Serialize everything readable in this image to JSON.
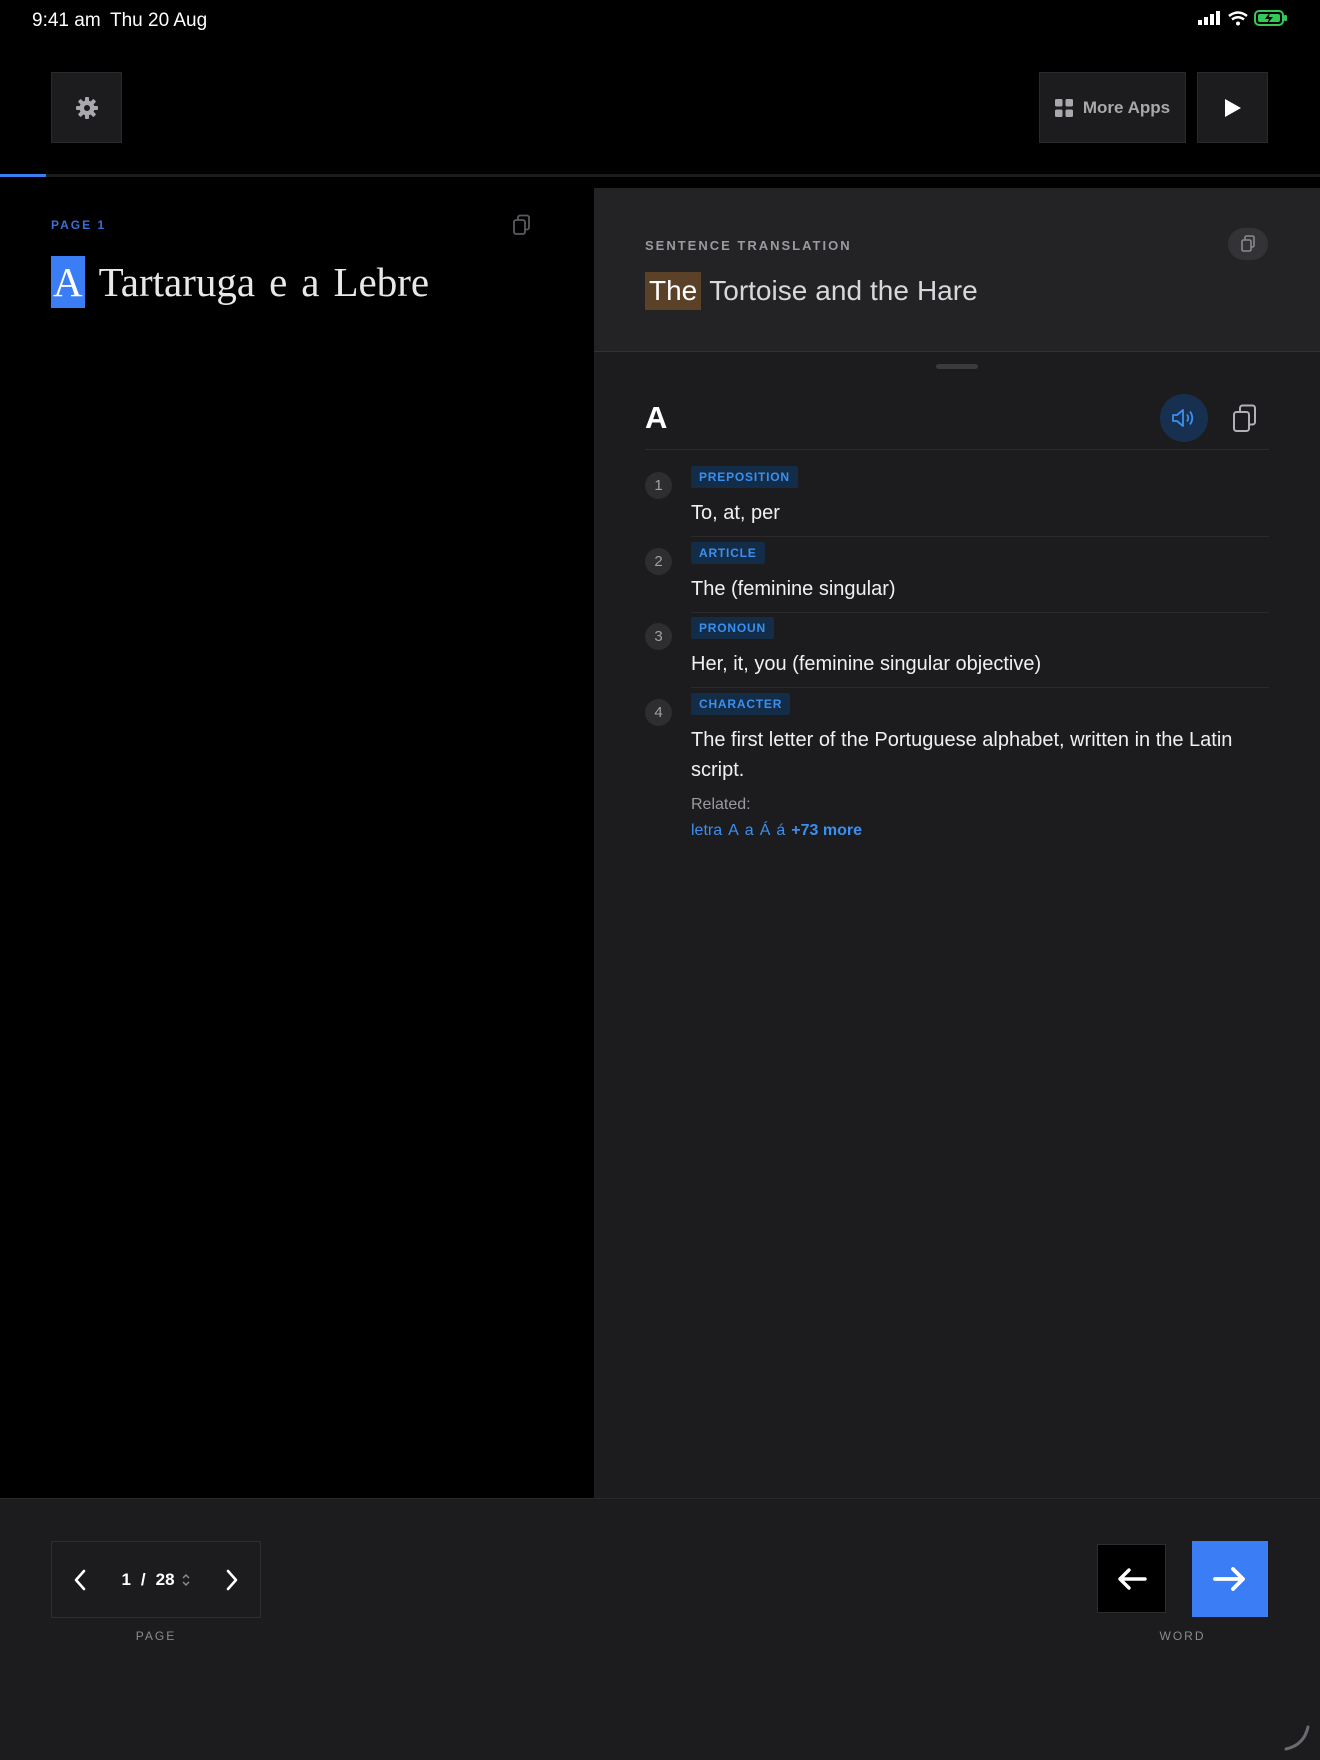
{
  "status_bar": {
    "time": "9:41 am",
    "date": "Thu 20 Aug",
    "battery_color": "#34c759"
  },
  "toolbar": {
    "more_apps_label": "More Apps",
    "progress_percent": 3.5,
    "accent_color": "#3a7df5"
  },
  "source": {
    "page_label": "PAGE 1",
    "words": [
      "A",
      "Tartaruga",
      "e",
      "a",
      "Lebre"
    ],
    "active_index": 0
  },
  "translation": {
    "label": "SENTENCE TRANSLATION",
    "words": [
      "The",
      "Tortoise",
      "and",
      "the",
      "Hare"
    ],
    "active_index": 0
  },
  "entry": {
    "headword": "A",
    "senses": [
      {
        "num": "1",
        "pos": "PREPOSITION",
        "definition": "To, at, per"
      },
      {
        "num": "2",
        "pos": "ARTICLE",
        "definition": "The (feminine singular)"
      },
      {
        "num": "3",
        "pos": "PRONOUN",
        "definition": "Her, it, you (feminine singular objective)"
      },
      {
        "num": "4",
        "pos": "CHARACTER",
        "definition": "The first letter of the Portuguese alphabet, written in the Latin script."
      }
    ],
    "related_label": "Related:",
    "related": [
      "letra",
      "A",
      "a",
      "Á",
      "á"
    ],
    "related_more": "+73 more"
  },
  "pager": {
    "current": "1",
    "separator": "/",
    "total": "28",
    "caption": "PAGE"
  },
  "word_nav": {
    "caption": "WORD"
  }
}
